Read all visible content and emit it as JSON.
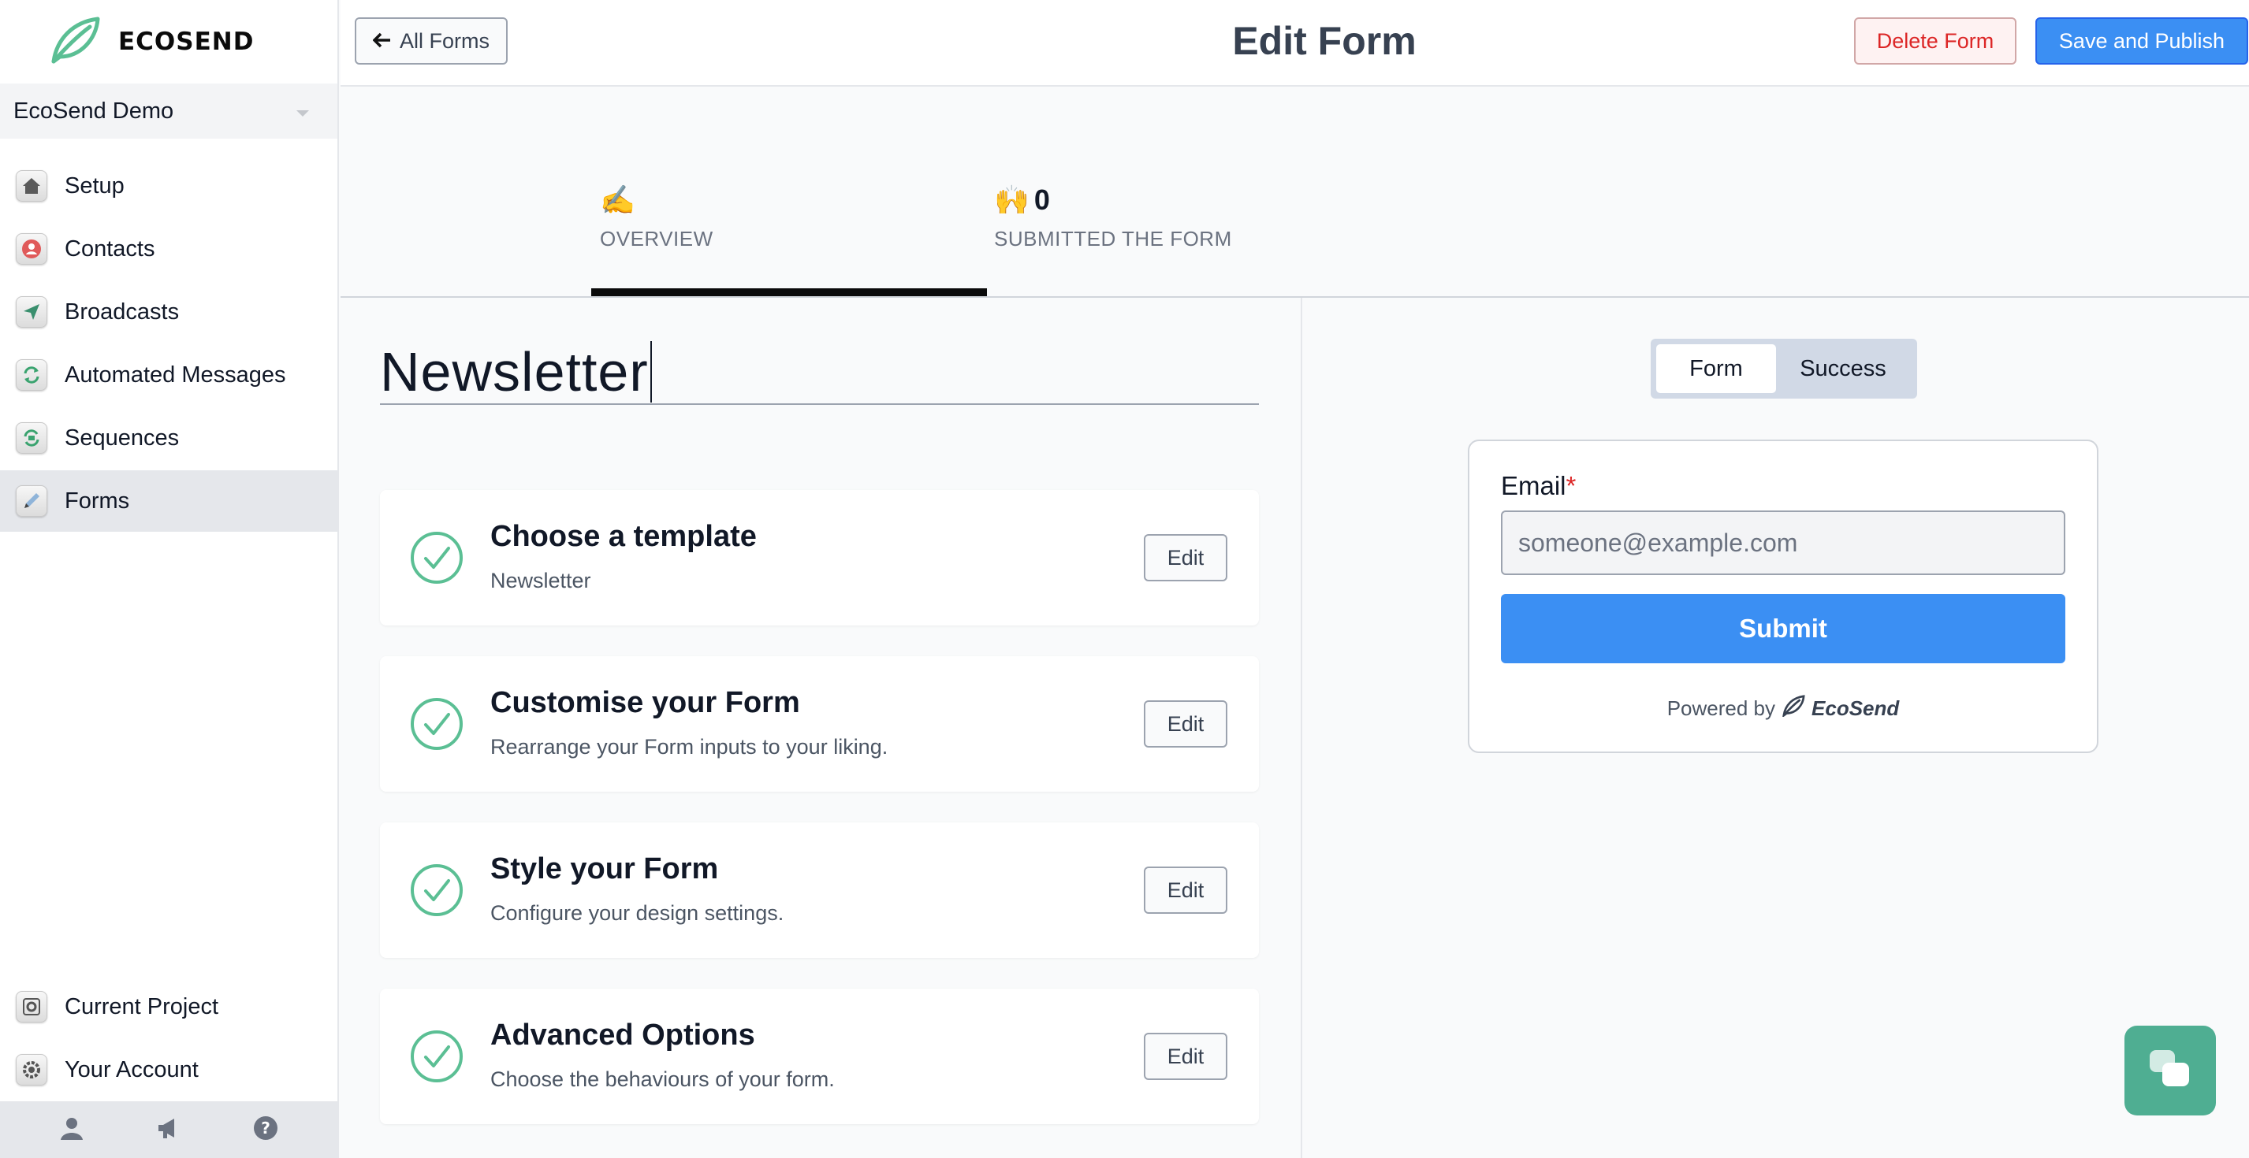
{
  "brand": {
    "name": "ECOSEND"
  },
  "sidebar": {
    "project": "EcoSend Demo",
    "items": [
      {
        "label": "Setup",
        "icon": "home-icon"
      },
      {
        "label": "Contacts",
        "icon": "contacts-icon"
      },
      {
        "label": "Broadcasts",
        "icon": "paper-plane-icon"
      },
      {
        "label": "Automated Messages",
        "icon": "refresh-icon"
      },
      {
        "label": "Sequences",
        "icon": "sequence-icon"
      },
      {
        "label": "Forms",
        "icon": "pencil-icon",
        "active": true
      }
    ],
    "bottom_items": [
      {
        "label": "Current Project",
        "icon": "gear-icon"
      },
      {
        "label": "Your Account",
        "icon": "gear-icon"
      }
    ],
    "footer_icons": [
      "user-icon",
      "megaphone-icon",
      "help-icon"
    ]
  },
  "topbar": {
    "back_label": "All Forms",
    "title": "Edit Form",
    "delete_label": "Delete Form",
    "save_label": "Save and Publish"
  },
  "stats": {
    "overview": {
      "emoji": "✍️",
      "label": "OVERVIEW"
    },
    "submitted": {
      "emoji": "🙌",
      "count": "0",
      "label": "SUBMITTED THE FORM"
    }
  },
  "form": {
    "name": "Newsletter",
    "steps": [
      {
        "title": "Choose a template",
        "desc": "Newsletter",
        "edit": "Edit"
      },
      {
        "title": "Customise your Form",
        "desc": "Rearrange your Form inputs to your liking.",
        "edit": "Edit"
      },
      {
        "title": "Style your Form",
        "desc": "Configure your design settings.",
        "edit": "Edit"
      },
      {
        "title": "Advanced Options",
        "desc": "Choose the behaviours of your form.",
        "edit": "Edit"
      }
    ]
  },
  "preview": {
    "toggle": {
      "form": "Form",
      "success": "Success"
    },
    "email_label": "Email",
    "required_mark": "*",
    "email_placeholder": "someone@example.com",
    "submit_label": "Submit",
    "powered_by": "Powered by",
    "powered_brand": "EcoSend"
  },
  "colors": {
    "primary": "#3b8ff3",
    "danger": "#dc2626",
    "success_check": "#5bbf94",
    "chat": "#4fae92"
  }
}
